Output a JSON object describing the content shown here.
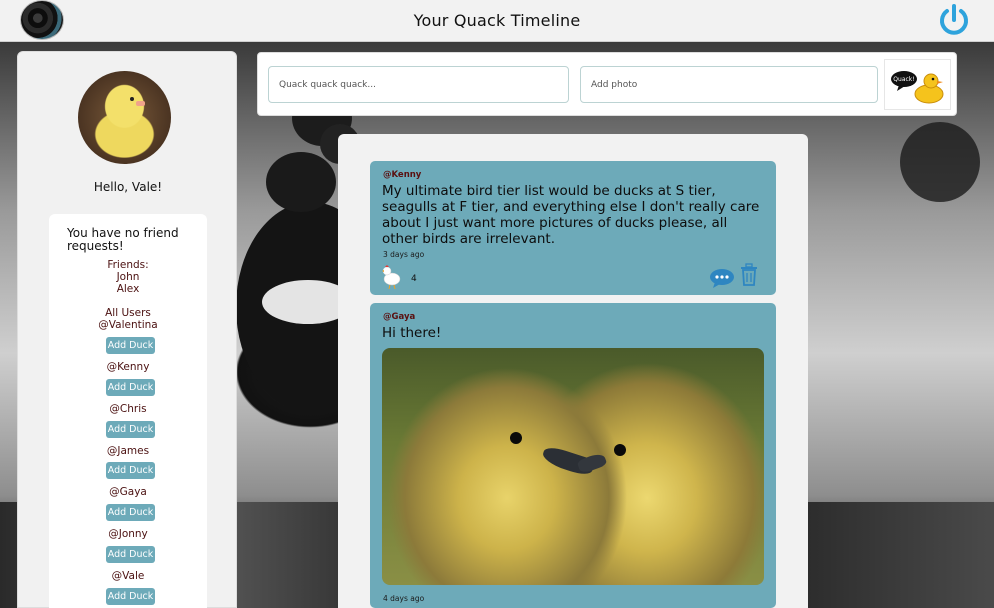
{
  "header": {
    "title": "Your Quack Timeline",
    "power_icon": "power-icon",
    "accent": "#2ea3dc"
  },
  "sidebar": {
    "greeting": "Hello, Vale!",
    "no_requests": "You have no friend requests!",
    "friends_label": "Friends:",
    "friends": [
      "John",
      "Alex"
    ],
    "all_users_label": "All Users",
    "add_label": "Add Duck",
    "users": [
      "@Valentina",
      "@Kenny",
      "@Chris",
      "@James",
      "@Gaya",
      "@Jonny",
      "@Vale"
    ]
  },
  "composer": {
    "text_placeholder": "Quack quack quack...",
    "photo_placeholder": "Add photo",
    "quack_button_text": "Quack!"
  },
  "posts": [
    {
      "author": "@Kenny",
      "text": "My ultimate bird tier list would be ducks at S tier, seagulls at F tier, and everything else I don't really care about I just want more pictures of ducks please, all other birds are irrelevant.",
      "time": "3 days ago",
      "likes": "4"
    },
    {
      "author": "@Gaya",
      "text": "Hi there!",
      "time": "4 days ago"
    }
  ],
  "colors": {
    "post_bg": "#6daab9",
    "button_bg": "#6daab9",
    "name_text": "#4a1010"
  }
}
